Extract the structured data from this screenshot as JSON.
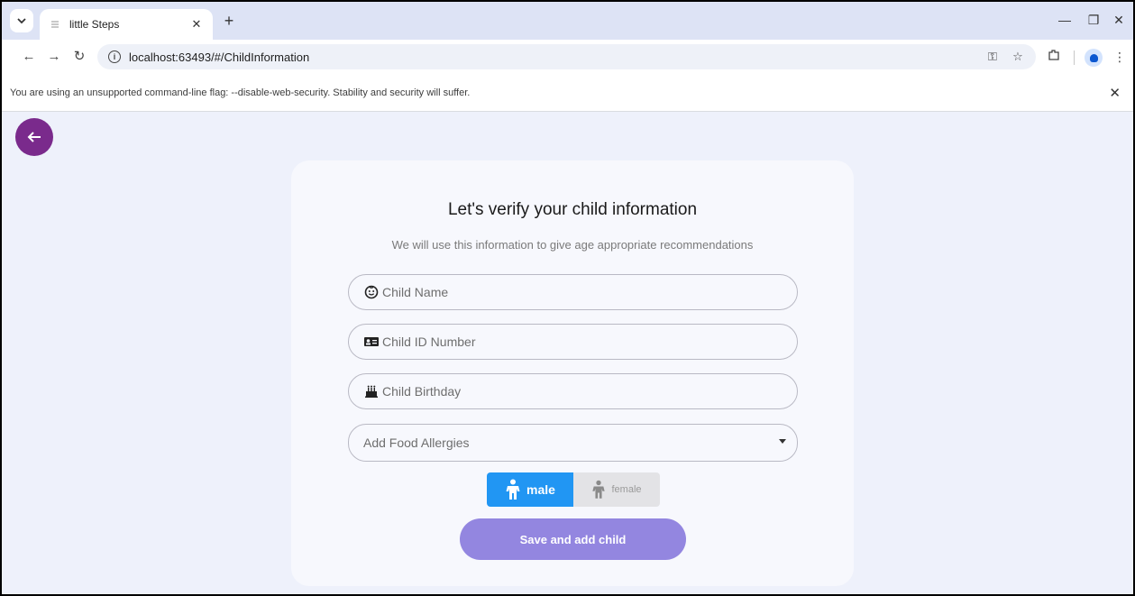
{
  "browser": {
    "tab_title": "little Steps",
    "url": "localhost:63493/#/ChildInformation",
    "infobar_text": "You are using an unsupported command-line flag: --disable-web-security. Stability and security will suffer."
  },
  "page": {
    "title": "Let's verify your child information",
    "subtitle": "We will use this information to give age appropriate recommendations",
    "fields": {
      "child_name_placeholder": "Child Name",
      "child_id_placeholder": "Child ID Number",
      "child_birthday_placeholder": "Child Birthday",
      "food_allergies_label": "Add Food Allergies"
    },
    "gender": {
      "male_label": "male",
      "female_label": "female",
      "selected": "male"
    },
    "save_button_label": "Save and add child"
  },
  "colors": {
    "back_button": "#7a2a8c",
    "male_selected": "#2196f3",
    "save_button": "#9386e0",
    "page_background": "#eef1fb"
  }
}
